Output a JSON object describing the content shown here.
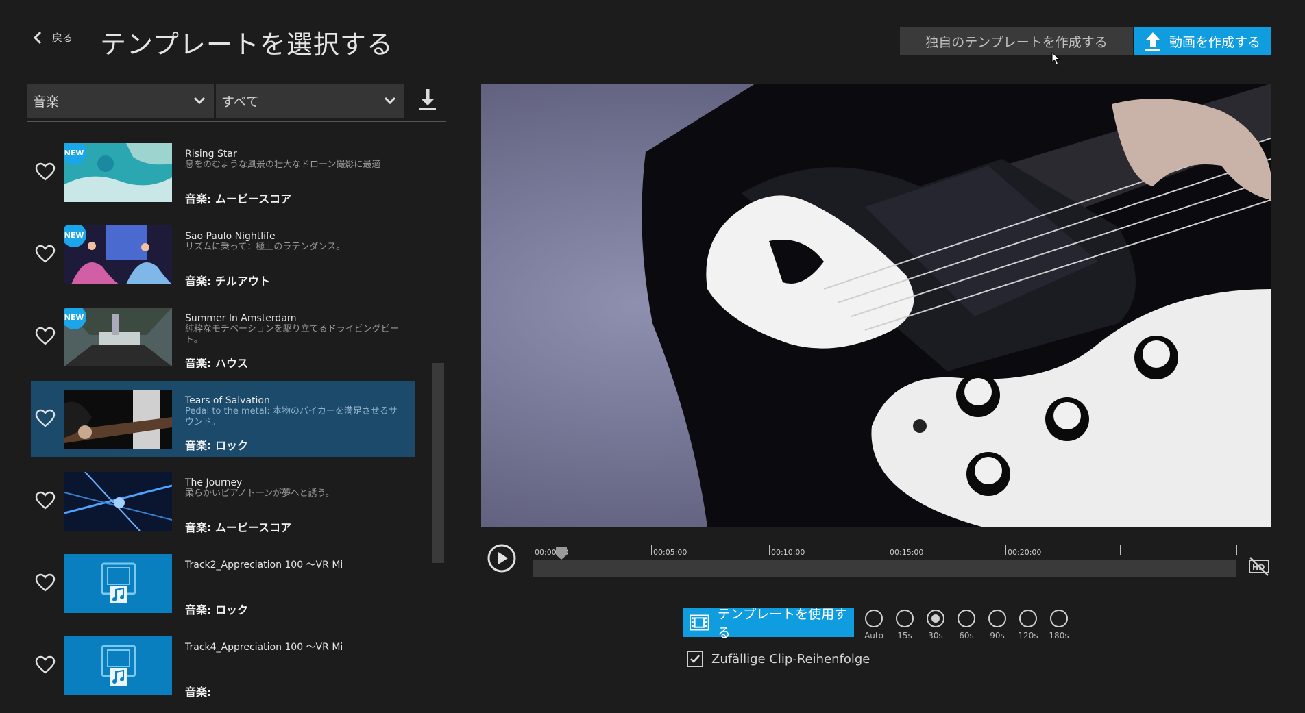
{
  "header": {
    "back_label": "戻る",
    "title": "テンプレートを選択する",
    "own_template_button": "独自のテンプレートを作成する",
    "create_video_button": "動画を作成する"
  },
  "filters": {
    "category": "音楽",
    "subcategory": "すべて"
  },
  "templates": [
    {
      "name": "Rising Star",
      "desc": "息をのむような風景の壮大なドローン撮影に最適",
      "genre": "音楽: ムービースコア",
      "badge": "NEW",
      "thumb": "aerial-coast"
    },
    {
      "name": "Sao Paulo Nightlife",
      "desc": "リズムに乗って：極上のラテンダンス。",
      "genre": "音楽: チルアウト",
      "badge": "NEW",
      "thumb": "dancers"
    },
    {
      "name": "Summer In Amsterdam",
      "desc": "純粋なモチベーションを駆り立てるドライビングビート。",
      "genre": "音楽: ハウス",
      "badge": "NEW",
      "thumb": "city-fisheye"
    },
    {
      "name": "Tears of Salvation",
      "desc": "Pedal to the metal: 本物のバイカーを満足させるサウンド。",
      "genre": "音楽: ロック",
      "badge": "",
      "thumb": "guitar"
    },
    {
      "name": "The Journey",
      "desc": "柔らかいピアノトーンが夢へと誘う。",
      "genre": "音楽: ムービースコア",
      "badge": "",
      "thumb": "night-city"
    },
    {
      "name": "Track2_Appreciation 100 ～VR Mi",
      "desc": "",
      "genre": "音楽: ロック",
      "badge": "",
      "thumb": "placeholder"
    },
    {
      "name": "Track4_Appreciation 100 ～VR Mi",
      "desc": "",
      "genre": "音楽:",
      "badge": "",
      "thumb": "placeholder"
    }
  ],
  "timeline": {
    "labels": [
      "00:00:00",
      "00:05:00",
      "00:10:00",
      "00:15:00",
      "00:20:00"
    ]
  },
  "template_controls": {
    "use_template_button": "テンプレートを使用する",
    "durations": [
      "Auto",
      "15s",
      "30s",
      "60s",
      "90s",
      "120s",
      "180s"
    ],
    "selected_duration": "30s",
    "shuffle_label": "Zufällige Clip-Reihenfolge",
    "shuffle_checked": true
  },
  "colors": {
    "accent": "#0f9ddf",
    "selected_row": "#1b4a6a",
    "background": "#1c1c1c"
  }
}
